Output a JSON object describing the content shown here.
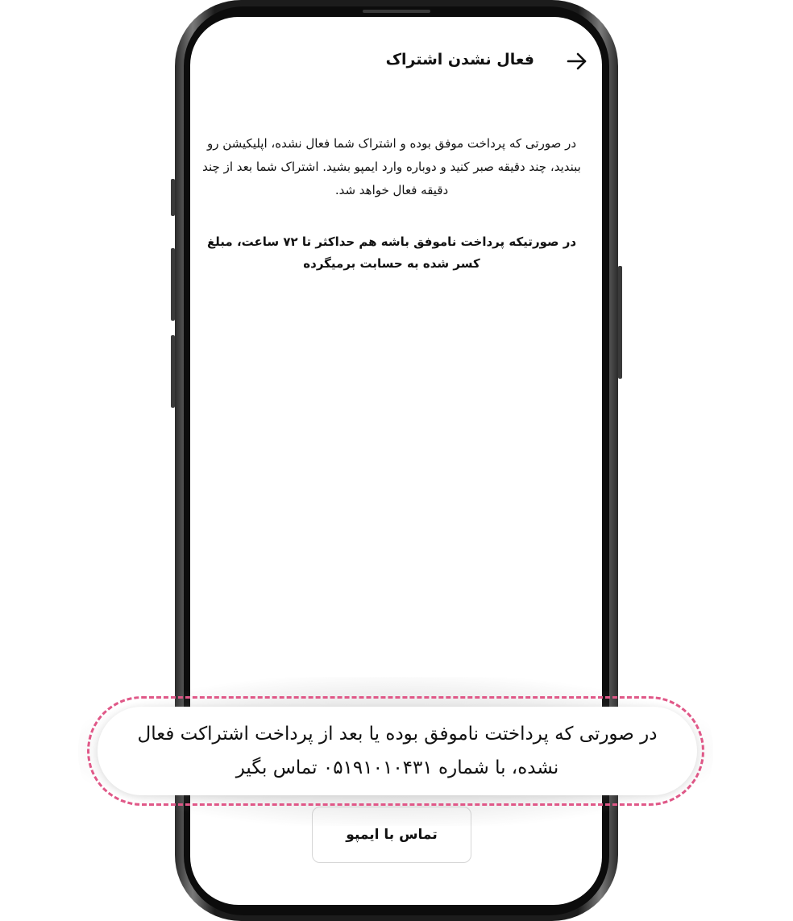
{
  "header": {
    "title": "فعال نشدن اشتراک",
    "back_icon": "arrow-right-icon"
  },
  "content": {
    "paragraph_1": "در صورتی که پرداخت موفق بوده و اشتراک شما فعال نشده، اپلیکیشن رو ببندید، چند دقیقه صبر کنید و دوباره وارد ایمپو بشید. اشتراک شما بعد از چند دقیقه فعال خواهد شد.",
    "paragraph_2": "در صورتیکه پرداخت ناموفق باشه هم حداکثر تا ۷۲ ساعت، مبلغ کسر شده به حسابت برمیگرده"
  },
  "actions": {
    "contact_label": "تماس با ایمپو"
  },
  "callout": {
    "text": "در صورتی که پرداختت ناموفق بوده یا بعد از پرداخت اشتراکت فعال نشده، با شماره ۰۵۱۹۱۰۱۰۴۳۱ تماس بگیر",
    "border_color": "#e05888"
  }
}
